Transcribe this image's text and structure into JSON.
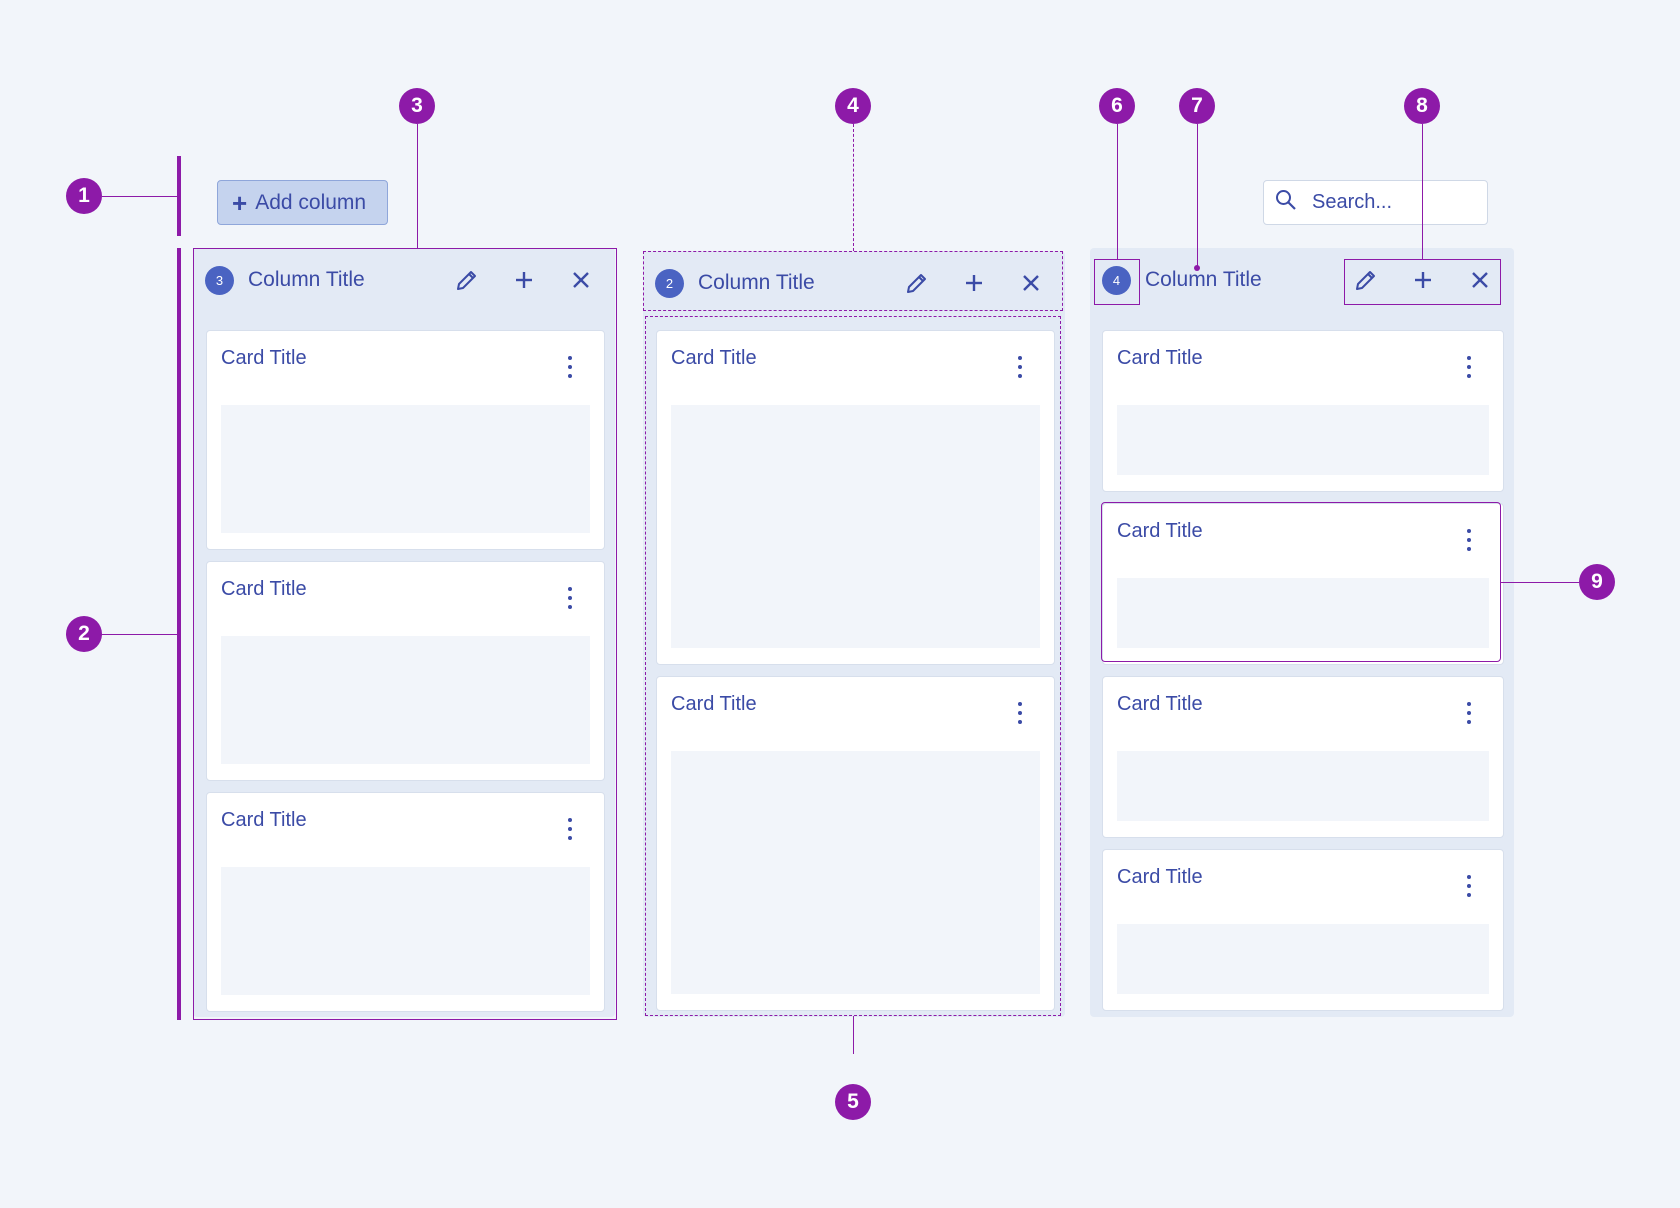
{
  "toolbar": {
    "add_column_label": "Add column",
    "search_placeholder": "Search..."
  },
  "columns": [
    {
      "count": "3",
      "title": "Column Title",
      "cards": [
        {
          "title": "Card Title"
        },
        {
          "title": "Card Title"
        },
        {
          "title": "Card Title"
        }
      ]
    },
    {
      "count": "2",
      "title": "Column Title",
      "cards": [
        {
          "title": "Card Title"
        },
        {
          "title": "Card Title"
        }
      ]
    },
    {
      "count": "4",
      "title": "Column Title",
      "cards": [
        {
          "title": "Card Title"
        },
        {
          "title": "Card Title"
        },
        {
          "title": "Card Title"
        },
        {
          "title": "Card Title"
        }
      ]
    }
  ],
  "annotations": [
    "1",
    "2",
    "3",
    "4",
    "5",
    "6",
    "7",
    "8",
    "9"
  ],
  "icons": [
    "plus-icon",
    "search-icon",
    "pencil-icon",
    "close-icon",
    "more-vertical-icon"
  ],
  "colors": {
    "background": "#f2f5fa",
    "column": "#e3eaf5",
    "accent": "#3b4ba6",
    "badge": "#4a63c2",
    "annotation": "#8d1aa8",
    "button": "#c5d3ee"
  }
}
